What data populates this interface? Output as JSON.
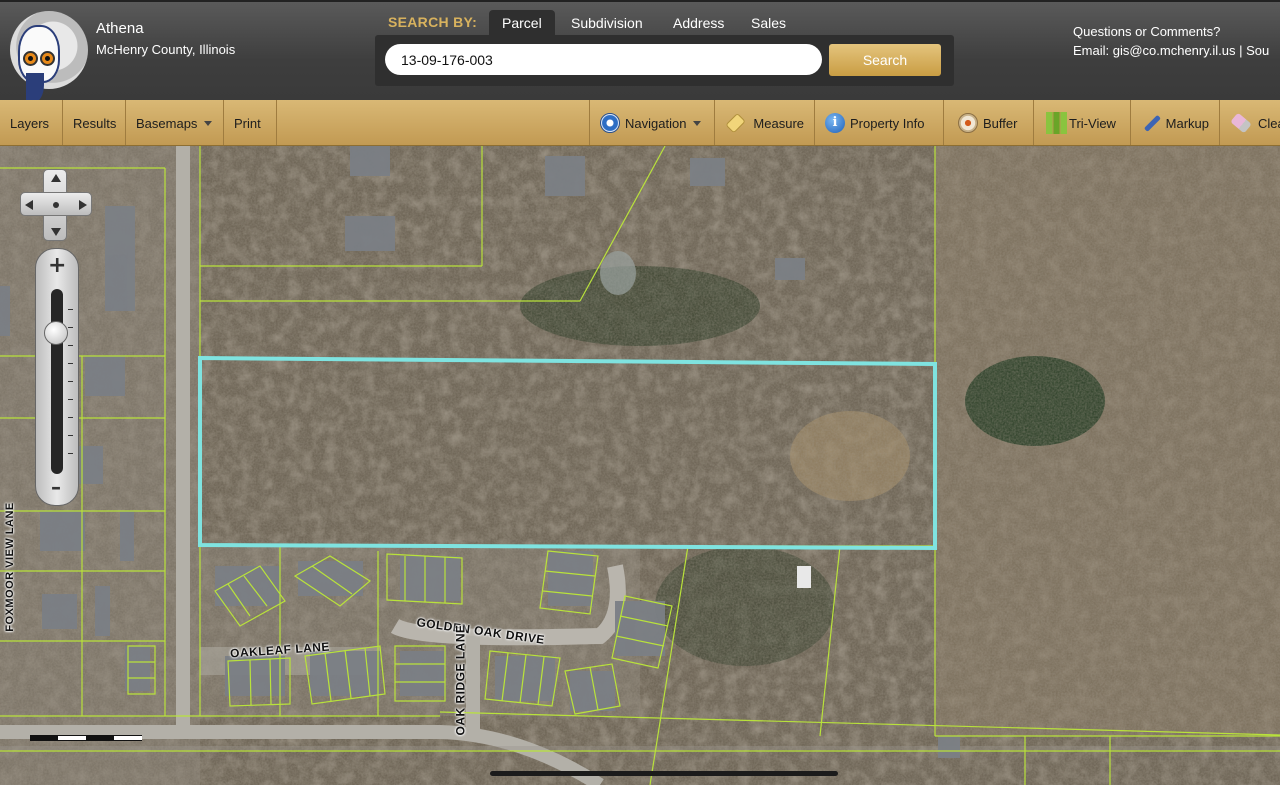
{
  "header": {
    "app_title": "Athena",
    "app_subtitle": "McHenry County, Illinois",
    "search_by_label": "SEARCH BY:",
    "tabs": [
      {
        "label": "Parcel",
        "active": true
      },
      {
        "label": "Subdivision",
        "active": false
      },
      {
        "label": "Address",
        "active": false
      },
      {
        "label": "Sales",
        "active": false
      }
    ],
    "search_value": "13-09-176-003",
    "search_button": "Search",
    "contact_line1": "Questions or Comments?",
    "contact_line2": "Email: gis@co.mchenry.il.us  |  Sou"
  },
  "toolbar": {
    "left": [
      "Layers",
      "Results",
      "Basemaps",
      "Print"
    ],
    "right": [
      {
        "label": "Navigation",
        "icon": "navigation-icon",
        "dropdown": true
      },
      {
        "label": "Measure",
        "icon": "ruler-icon"
      },
      {
        "label": "Property Info",
        "icon": "info-icon"
      },
      {
        "label": "Buffer",
        "icon": "buffer-icon"
      },
      {
        "label": "Tri-View",
        "icon": "tri-view-icon"
      },
      {
        "label": "Markup",
        "icon": "pencil-icon"
      },
      {
        "label": "Clea",
        "icon": "eraser-icon"
      }
    ]
  },
  "map": {
    "street_labels": [
      "GOLDEN OAK DRIVE",
      "OAKLEAF LANE",
      "OAK RIDGE LANE",
      "FOXMOOR VIEW LANE"
    ],
    "highlight_color": "#7fe3e0",
    "parcel_line_color": "#b9e23b"
  },
  "colors": {
    "header_bg": "#3e3e3e",
    "accent_gold": "#d8b25e",
    "toolbar_bg": "#c9a35b"
  }
}
